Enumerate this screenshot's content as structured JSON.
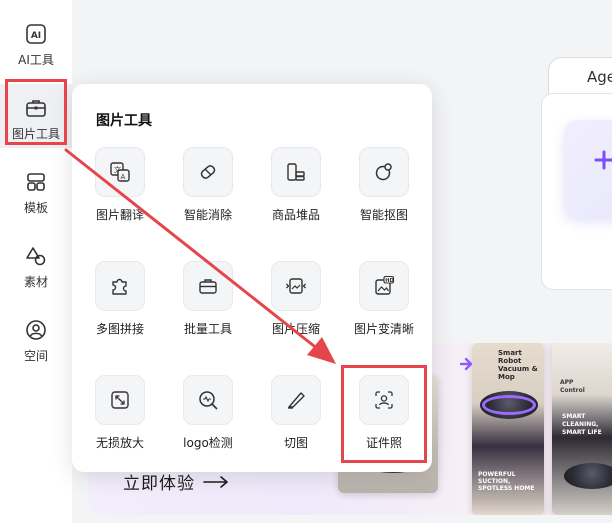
{
  "rail": {
    "items": [
      {
        "label": "AI工具",
        "icon": "ai-icon"
      },
      {
        "label": "图片工具",
        "icon": "toolbox-icon",
        "active": true
      },
      {
        "label": "模板",
        "icon": "template-icon"
      },
      {
        "label": "素材",
        "icon": "shapes-icon"
      },
      {
        "label": "空间",
        "icon": "user-space-icon"
      }
    ]
  },
  "popover": {
    "title": "图片工具",
    "tools": [
      {
        "label": "图片翻译",
        "icon": "image-translate-icon"
      },
      {
        "label": "智能消除",
        "icon": "eraser-icon"
      },
      {
        "label": "商品堆品",
        "icon": "product-stack-icon"
      },
      {
        "label": "智能抠图",
        "icon": "cutout-icon"
      },
      {
        "label": "多图拼接",
        "icon": "puzzle-icon"
      },
      {
        "label": "批量工具",
        "icon": "batch-toolbox-icon"
      },
      {
        "label": "图片压缩",
        "icon": "compress-icon"
      },
      {
        "label": "图片变清晰",
        "icon": "hd-image-icon"
      },
      {
        "label": "无损放大",
        "icon": "expand-icon"
      },
      {
        "label": "logo检测",
        "icon": "logo-detect-icon"
      },
      {
        "label": "切图",
        "icon": "knife-icon"
      },
      {
        "label": "证件照",
        "icon": "id-photo-icon"
      }
    ]
  },
  "background": {
    "tab_label": "Age",
    "banner_cta": "立即体验",
    "promo_texts": [
      "Smart Robot Vacuum & Mop",
      "POWERFUL SUCTION, SPOTLESS HOME",
      "APP Control",
      "SMART CLEANING, SMART LIFE"
    ]
  },
  "colors": {
    "annotation": "#e5464a",
    "accent": "#7c4dff"
  }
}
